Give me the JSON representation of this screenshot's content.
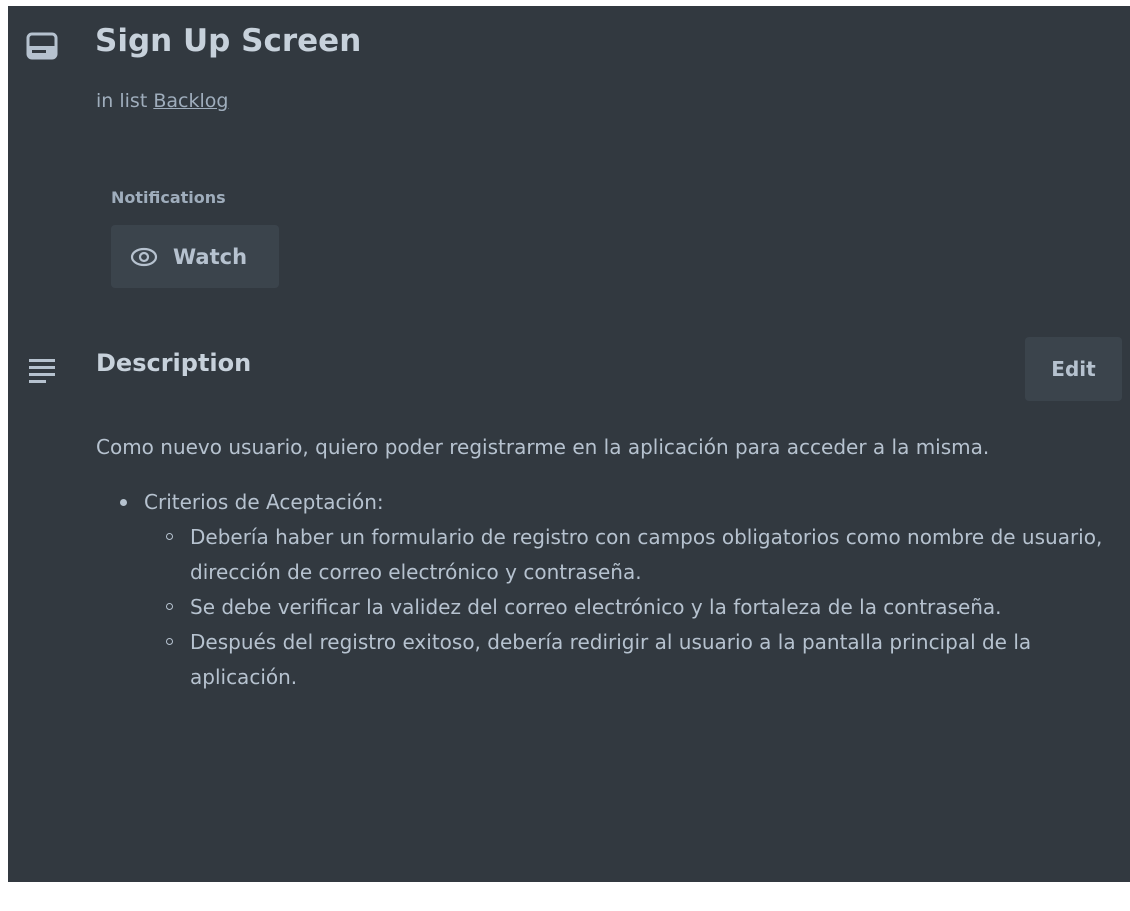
{
  "card": {
    "title": "Sign Up Screen",
    "list_prefix": "in list",
    "list_name": "Backlog",
    "icon": "card-icon"
  },
  "notifications": {
    "label": "Notifications",
    "watch_label": "Watch",
    "watch_icon": "eye-icon"
  },
  "description": {
    "title": "Description",
    "icon": "description-icon",
    "edit_label": "Edit",
    "intro": "Como nuevo usuario, quiero poder registrarme en la aplicación para acceder a la misma.",
    "items": [
      {
        "label": "Criterios de Aceptación:",
        "subitems": [
          "Debería haber un formulario de registro con campos obligatorios como nombre de usuario, dirección de correo electrónico y contraseña.",
          "Se debe verificar la validez del correo electrónico y la fortaleza de la contraseña.",
          "Después del registro exitoso, debería redirigir al usuario a la pantalla principal de la aplicación."
        ]
      }
    ]
  },
  "colors": {
    "panel_bg": "#323940",
    "button_bg": "#3b444c",
    "text": "#b6c2cf",
    "heading": "#c7d1db"
  }
}
